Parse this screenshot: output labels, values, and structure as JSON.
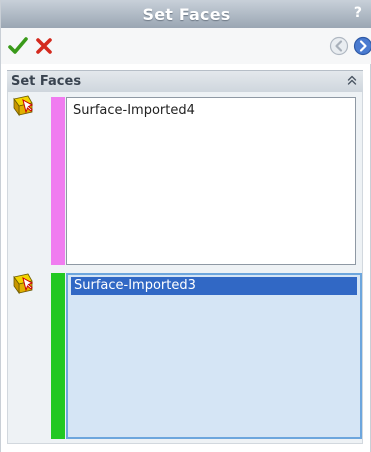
{
  "window": {
    "title": "Set Faces",
    "help_label": "?"
  },
  "toolbar": {
    "ok_icon": "checkmark-icon",
    "cancel_icon": "close-x-icon",
    "back_icon": "back-arrow-icon",
    "forward_icon": "forward-arrow-icon"
  },
  "section": {
    "title": "Set Faces",
    "collapse_glyph": "«"
  },
  "selections": [
    {
      "color": "#f07cf0",
      "icon": "face-selection-icon",
      "items": [
        "Surface-Imported4"
      ],
      "active": false
    },
    {
      "color": "#22c822",
      "icon": "face-selection-icon",
      "items": [
        "Surface-Imported3"
      ],
      "active": true,
      "selected_index": 0
    }
  ],
  "colors": {
    "titlebar_top": "#c8d0d9",
    "titlebar_bottom": "#9aa6b3",
    "ok_green": "#3a9a1a",
    "cancel_red": "#d42a1e",
    "nav_blue": "#4a7bd0",
    "selected_highlight": "#3168c5"
  }
}
